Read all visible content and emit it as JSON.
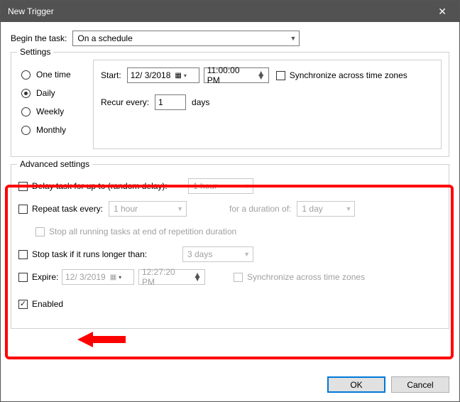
{
  "window": {
    "title": "New Trigger",
    "close": "✕"
  },
  "begin": {
    "label": "Begin the task:",
    "value": "On a schedule"
  },
  "settings": {
    "legend": "Settings",
    "radios": {
      "one_time": "One time",
      "daily": "Daily",
      "weekly": "Weekly",
      "monthly": "Monthly"
    },
    "selected": "daily",
    "start_label": "Start:",
    "start_date": "12/  3/2018",
    "start_time": "11:00:00 PM",
    "sync_label": "Synchronize across time zones",
    "recur_label": "Recur every:",
    "recur_value": "1",
    "recur_unit": "days"
  },
  "advanced": {
    "legend": "Advanced settings",
    "delay_label": "Delay task for up to (random delay):",
    "delay_value": "1 hour",
    "repeat_label": "Repeat task every:",
    "repeat_value": "1 hour",
    "repeat_duration_label": "for a duration of:",
    "repeat_duration_value": "1 day",
    "stop_repeat_label": "Stop all running tasks at end of repetition duration",
    "stop_longer_label": "Stop task if it runs longer than:",
    "stop_longer_value": "3 days",
    "expire_label": "Expire:",
    "expire_date": "12/  3/2019",
    "expire_time": "12:27:20 PM",
    "expire_sync_label": "Synchronize across time zones",
    "enabled_label": "Enabled"
  },
  "buttons": {
    "ok": "OK",
    "cancel": "Cancel"
  }
}
